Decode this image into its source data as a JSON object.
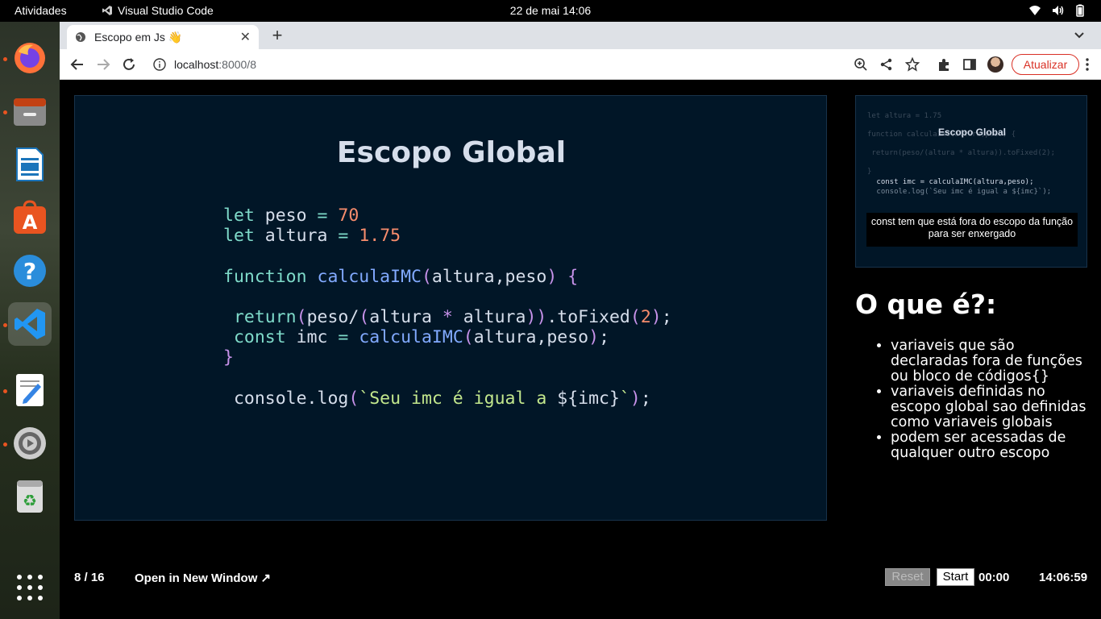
{
  "topbar": {
    "activities": "Atividades",
    "app_name": "Visual Studio Code",
    "clock": "22 de mai  14:06"
  },
  "dock": {
    "items": [
      "firefox",
      "files",
      "libreoffice-writer",
      "app-center",
      "help",
      "visual-studio-code",
      "text-editor",
      "settings",
      "trash"
    ]
  },
  "browser": {
    "tab_title": "Escopo em Js 👋",
    "new_tab": "+",
    "url_host": "localhost",
    "url_path": ":8000/8",
    "update_label": "Atualizar"
  },
  "slide": {
    "title": "Escopo Global",
    "code_lines": [
      "let peso = 70",
      "let altura = 1.75",
      "",
      "function calculaIMC(altura,peso) {",
      "",
      " return(peso/(altura * altura)).toFixed(2);",
      " const imc = calculaIMC(altura,peso);",
      "}",
      "",
      " console.log(`Seu imc é igual a ${imc}`);"
    ]
  },
  "preview": {
    "title": "Escopo Global",
    "ghost_lines": [
      "let altura = 1.75",
      "",
      "function calculaIMC(altura,peso) {",
      "",
      " return(peso/(altura * altura)).toFixed(2);",
      "",
      "}"
    ],
    "code_lines": [
      " const imc = calculaIMC(altura,peso);",
      " console.log(`Seu imc é igual a ${imc}`);"
    ],
    "note": "const tem que está fora do escopo da função para ser enxergado"
  },
  "notes": {
    "title": "O que é?:",
    "items": [
      "variaveis que são declaradas fora de funções ou bloco de códigos{}",
      "variaveis definidas no escopo global sao definidas como variaveis globais",
      "podem ser acessadas de qualquer outro escopo"
    ]
  },
  "footer": {
    "pages": "8 / 16",
    "open_window": "Open in New Window ↗",
    "reset": "Reset",
    "start": "Start",
    "timer": "00:00",
    "clock": "14:06:59"
  }
}
